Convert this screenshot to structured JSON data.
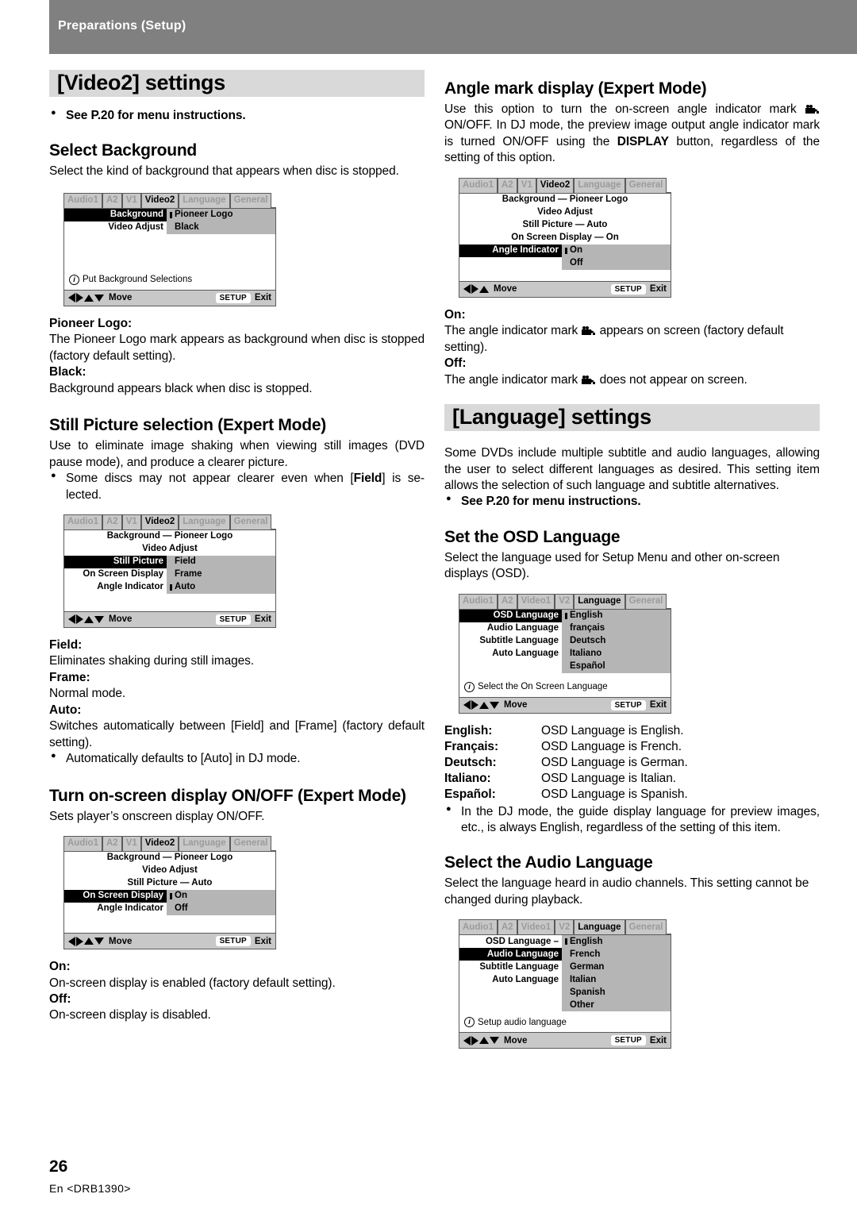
{
  "header": {
    "title": "Preparations (Setup)"
  },
  "footer": {
    "page_number": "26",
    "doc_code": "En <DRB1390>"
  },
  "left": {
    "banner": "[Video2] settings",
    "see_menu": "See P.20 for menu instructions.",
    "select_background": {
      "heading": "Select Background",
      "intro": "Select the kind of background that appears when disc is stopped.",
      "terms": [
        {
          "term": "Pioneer Logo:",
          "desc": "The Pioneer Logo mark appears as background when disc is stopped (factory default setting)."
        },
        {
          "term": "Black:",
          "desc": "Background appears black when disc is stopped."
        }
      ]
    },
    "still_picture": {
      "heading": "Still Picture selection (Expert Mode)",
      "intro": "Use to eliminate image shaking when viewing still images (DVD pause mode), and produce a clearer picture.",
      "bullet": "Some discs may not appear clearer even when [Field] is selected.",
      "bullet_pre": "Some discs may not appear clearer even when [",
      "bullet_bold": "Field",
      "bullet_post": "] is se-lected.",
      "terms": [
        {
          "term": "Field:",
          "desc": "Eliminates shaking during still images."
        },
        {
          "term": "Frame:",
          "desc": "Normal mode."
        },
        {
          "term": "Auto:",
          "desc": "Switches automatically between [Field] and [Frame] (factory default setting)."
        }
      ],
      "bullet2": "Automatically defaults to [Auto] in DJ mode."
    },
    "osd_toggle": {
      "heading": "Turn on-screen display ON/OFF (Expert Mode)",
      "intro": "Sets player’s onscreen display ON/OFF.",
      "terms": [
        {
          "term": "On:",
          "desc": "On-screen display is enabled (factory default setting)."
        },
        {
          "term": "Off:",
          "desc": "On-screen display is disabled."
        }
      ]
    }
  },
  "right": {
    "angle_mark": {
      "heading": "Angle mark display (Expert Mode)",
      "para_a": "Use this option to turn the on-screen angle indicator mark",
      "para_b": "ON/OFF. In DJ mode, the preview image output angle indicator mark is turned ON/OFF using the",
      "para_bold": "DISPLAY",
      "para_c": "button, regardless of the setting of this option.",
      "on_term": "On:",
      "on_a": "The angle indicator mark",
      "on_b": "appears on screen (factory default setting).",
      "off_term": "Off:",
      "off_a": "The angle indicator mark",
      "off_b": "does not appear on screen."
    },
    "banner": "[Language] settings",
    "intro": "Some DVDs include multiple subtitle and audio languages, allowing the user to select different languages as desired. This setting item allows the selection of such language and subtitle alternatives.",
    "see_menu": "See P.20 for menu instructions.",
    "osd_language": {
      "heading": "Set the OSD Language",
      "intro": "Select the language used for Setup Menu and other on-screen displays (OSD).",
      "defs": [
        {
          "k": "English:",
          "v": "OSD Language is English."
        },
        {
          "k": "Français:",
          "v": "OSD Language is French."
        },
        {
          "k": "Deutsch:",
          "v": "OSD Language is German."
        },
        {
          "k": "Italiano:",
          "v": "OSD Language is Italian."
        },
        {
          "k": "Español:",
          "v": "OSD Language is Spanish."
        }
      ],
      "bullet": "In the DJ mode, the guide display language for preview images, etc., is always English, regardless of the setting of this item."
    },
    "audio_language": {
      "heading": "Select the Audio Language",
      "intro": "Select the language heard in audio channels. This setting cannot be changed during playback."
    }
  },
  "osd_menus": {
    "background": {
      "tabs": [
        {
          "label": "Audio1",
          "active": false
        },
        {
          "label": "A2",
          "active": false
        },
        {
          "label": "V1",
          "active": false
        },
        {
          "label": "Video2",
          "active": true
        },
        {
          "label": "Language",
          "active": false
        },
        {
          "label": "General",
          "active": false
        }
      ],
      "rows": [
        {
          "label": "Background",
          "value": "Pioneer Logo",
          "selected": true,
          "shaded": true,
          "marker": true
        },
        {
          "label": "Video Adjust",
          "value": "Black",
          "selected": false,
          "shaded": true,
          "marker": false
        }
      ],
      "info": "Put Background Selections",
      "move": "Move",
      "setup": "SETUP",
      "exit": "Exit",
      "arrows": [
        "left",
        "right",
        "up",
        "down"
      ]
    },
    "still_picture": {
      "tabs": [
        {
          "label": "Audio1",
          "active": false
        },
        {
          "label": "A2",
          "active": false
        },
        {
          "label": "V1",
          "active": false
        },
        {
          "label": "Video2",
          "active": true
        },
        {
          "label": "Language",
          "active": false
        },
        {
          "label": "General",
          "active": false
        }
      ],
      "rows": [
        {
          "label": "Background — Pioneer Logo",
          "value": "",
          "selected": false,
          "shaded": false,
          "marker": false,
          "full": true
        },
        {
          "label": "Video Adjust",
          "value": "",
          "selected": false,
          "shaded": false,
          "marker": false,
          "full": true
        },
        {
          "label": "Still Picture",
          "value": "Field",
          "selected": true,
          "shaded": true,
          "marker": false
        },
        {
          "label": "On Screen Display",
          "value": "Frame",
          "selected": false,
          "shaded": true,
          "marker": false
        },
        {
          "label": "Angle Indicator",
          "value": "Auto",
          "selected": false,
          "shaded": true,
          "marker": true
        }
      ],
      "info": "",
      "move": "Move",
      "setup": "SETUP",
      "exit": "Exit",
      "arrows": [
        "left",
        "right",
        "up",
        "down"
      ]
    },
    "on_screen_display": {
      "tabs": [
        {
          "label": "Audio1",
          "active": false
        },
        {
          "label": "A2",
          "active": false
        },
        {
          "label": "V1",
          "active": false
        },
        {
          "label": "Video2",
          "active": true
        },
        {
          "label": "Language",
          "active": false
        },
        {
          "label": "General",
          "active": false
        }
      ],
      "rows": [
        {
          "label": "Background — Pioneer Logo",
          "value": "",
          "selected": false,
          "shaded": false,
          "marker": false,
          "full": true
        },
        {
          "label": "Video Adjust",
          "value": "",
          "selected": false,
          "shaded": false,
          "marker": false,
          "full": true
        },
        {
          "label": "Still Picture — Auto",
          "value": "",
          "selected": false,
          "shaded": false,
          "marker": false,
          "full": true
        },
        {
          "label": "On Screen Display",
          "value": "On",
          "selected": true,
          "shaded": true,
          "marker": true
        },
        {
          "label": "Angle Indicator",
          "value": "Off",
          "selected": false,
          "shaded": true,
          "marker": false
        }
      ],
      "info": "",
      "move": "Move",
      "setup": "SETUP",
      "exit": "Exit",
      "arrows": [
        "left",
        "right",
        "up",
        "down"
      ]
    },
    "angle_indicator": {
      "tabs": [
        {
          "label": "Audio1",
          "active": false
        },
        {
          "label": "A2",
          "active": false
        },
        {
          "label": "V1",
          "active": false
        },
        {
          "label": "Video2",
          "active": true
        },
        {
          "label": "Language",
          "active": false
        },
        {
          "label": "General",
          "active": false
        }
      ],
      "rows": [
        {
          "label": "Background — Pioneer Logo",
          "value": "",
          "selected": false,
          "shaded": false,
          "marker": false,
          "full": true
        },
        {
          "label": "Video Adjust",
          "value": "",
          "selected": false,
          "shaded": false,
          "marker": false,
          "full": true
        },
        {
          "label": "Still Picture — Auto",
          "value": "",
          "selected": false,
          "shaded": false,
          "marker": false,
          "full": true
        },
        {
          "label": "On Screen Display — On",
          "value": "",
          "selected": false,
          "shaded": false,
          "marker": false,
          "full": true
        },
        {
          "label": "Angle Indicator",
          "value": "On",
          "selected": true,
          "shaded": true,
          "marker": true
        },
        {
          "label": "",
          "value": "Off",
          "selected": false,
          "shaded": true,
          "marker": false
        }
      ],
      "info": "",
      "move": "Move",
      "setup": "SETUP",
      "exit": "Exit",
      "arrows": [
        "left",
        "right",
        "up"
      ]
    },
    "osd_language": {
      "tabs": [
        {
          "label": "Audio1",
          "active": false
        },
        {
          "label": "A2",
          "active": false
        },
        {
          "label": "Video1",
          "active": false
        },
        {
          "label": "V2",
          "active": false
        },
        {
          "label": "Language",
          "active": true
        },
        {
          "label": "General",
          "active": false
        }
      ],
      "rows": [
        {
          "label": "OSD Language",
          "value": "English",
          "selected": true,
          "shaded": true,
          "marker": true
        },
        {
          "label": "Audio Language",
          "value": "français",
          "selected": false,
          "shaded": true,
          "marker": false
        },
        {
          "label": "Subtitle Language",
          "value": "Deutsch",
          "selected": false,
          "shaded": true,
          "marker": false
        },
        {
          "label": "Auto Language",
          "value": "Italiano",
          "selected": false,
          "shaded": true,
          "marker": false
        },
        {
          "label": "",
          "value": "Español",
          "selected": false,
          "shaded": true,
          "marker": false
        }
      ],
      "info": "Select the On Screen Language",
      "move": "Move",
      "setup": "SETUP",
      "exit": "Exit",
      "arrows": [
        "left",
        "right",
        "up",
        "down"
      ]
    },
    "audio_language": {
      "tabs": [
        {
          "label": "Audio1",
          "active": false
        },
        {
          "label": "A2",
          "active": false
        },
        {
          "label": "Video1",
          "active": false
        },
        {
          "label": "V2",
          "active": false
        },
        {
          "label": "Language",
          "active": true
        },
        {
          "label": "General",
          "active": false
        }
      ],
      "rows": [
        {
          "label": "OSD Language –",
          "value": "English",
          "selected": false,
          "shaded": true,
          "marker": true
        },
        {
          "label": "Audio Language",
          "value": "French",
          "selected": true,
          "shaded": true,
          "marker": false
        },
        {
          "label": "Subtitle Language",
          "value": "German",
          "selected": false,
          "shaded": true,
          "marker": false
        },
        {
          "label": "Auto Language",
          "value": "Italian",
          "selected": false,
          "shaded": true,
          "marker": false
        },
        {
          "label": "",
          "value": "Spanish",
          "selected": false,
          "shaded": true,
          "marker": false
        },
        {
          "label": "",
          "value": "Other",
          "selected": false,
          "shaded": true,
          "marker": false
        }
      ],
      "info": "Setup audio language",
      "move": "Move",
      "setup": "SETUP",
      "exit": "Exit",
      "arrows": [
        "left",
        "right",
        "up",
        "down"
      ]
    }
  }
}
